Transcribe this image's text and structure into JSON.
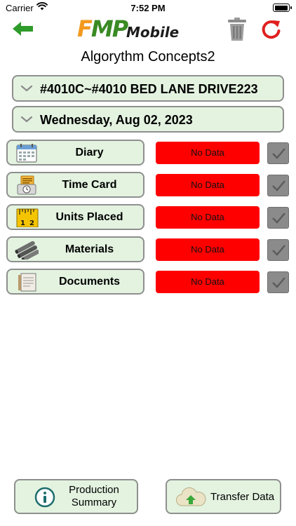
{
  "status_bar": {
    "carrier": "Carrier",
    "time": "7:52 PM",
    "battery_level": 1.0
  },
  "header": {
    "logo_fmp_f": "F",
    "logo_fmp_mp": "MP",
    "logo_mobile": "Mobile",
    "back_icon": "back-arrow-icon",
    "trash_icon": "trash-icon",
    "refresh_icon": "refresh-icon"
  },
  "company_name": "Algorythm Concepts2",
  "project_selector": {
    "label": "#4010C~#4010 BED LANE DRIVE223"
  },
  "date_selector": {
    "label": "Wednesday, Aug 02, 2023"
  },
  "modules": [
    {
      "label": "Diary",
      "status": "No Data",
      "icon": "calendar-icon",
      "checked": true
    },
    {
      "label": "Time Card",
      "status": "No Data",
      "icon": "time-card-icon",
      "checked": true
    },
    {
      "label": "Units Placed",
      "status": "No Data",
      "icon": "ruler-icon",
      "checked": true
    },
    {
      "label": "Materials",
      "status": "No Data",
      "icon": "pipes-icon",
      "checked": true
    },
    {
      "label": "Documents",
      "status": "No Data",
      "icon": "documents-icon",
      "checked": true
    }
  ],
  "bottom": {
    "production_summary_line1": "Production",
    "production_summary_line2": "Summary",
    "transfer_data": "Transfer Data"
  },
  "colors": {
    "accent_green": "#3a8a24",
    "button_bg": "#e3f3e0",
    "status_red": "#ff0000",
    "logo_orange": "#f39a1e"
  }
}
